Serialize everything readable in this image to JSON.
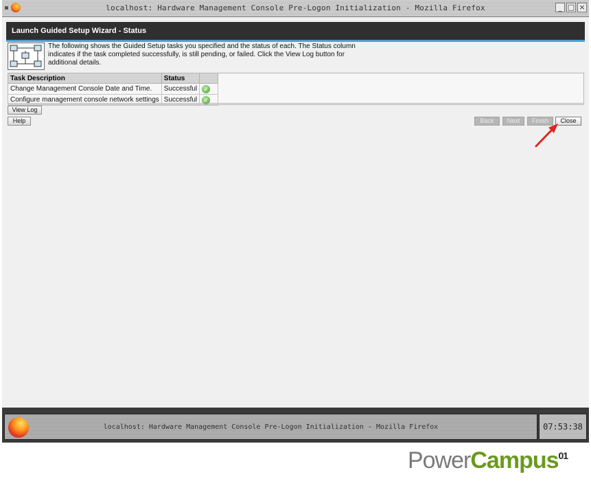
{
  "window": {
    "title": "localhost: Hardware Management Console Pre-Logon Initialization - Mozilla Firefox"
  },
  "page": {
    "title": "Launch Guided Setup Wizard - Status",
    "description": "The following shows the Guided Setup tasks you specified and the status of each. The Status column indicates if the task completed successfully, is still pending, or failed. Click the View Log button for additional details."
  },
  "table": {
    "columns": [
      "Task Description",
      "Status"
    ],
    "rows": [
      {
        "task": "Change Management Console Date and Time.",
        "status": "Successful",
        "status_icon": "check-circle-icon"
      },
      {
        "task": "Configure management console network settings",
        "status": "Successful",
        "status_icon": "check-circle-icon"
      }
    ]
  },
  "buttons": {
    "view_log": "View Log",
    "help": "Help",
    "back": "Back",
    "next": "Next",
    "finish": "Finish",
    "close": "Close"
  },
  "taskbar": {
    "item_label": "localhost: Hardware Management Console Pre-Logon Initialization - Mozilla Firefox",
    "clock": "07:53:38"
  },
  "watermark": {
    "power": "Power",
    "campus": "Campus",
    "sup": "01"
  },
  "colors": {
    "header_bg": "#2f2f2f",
    "header_accent": "#4f9ec9",
    "success": "#6fbe58",
    "annotation_arrow": "#e0261d",
    "brand_green": "#6a9a1e"
  }
}
